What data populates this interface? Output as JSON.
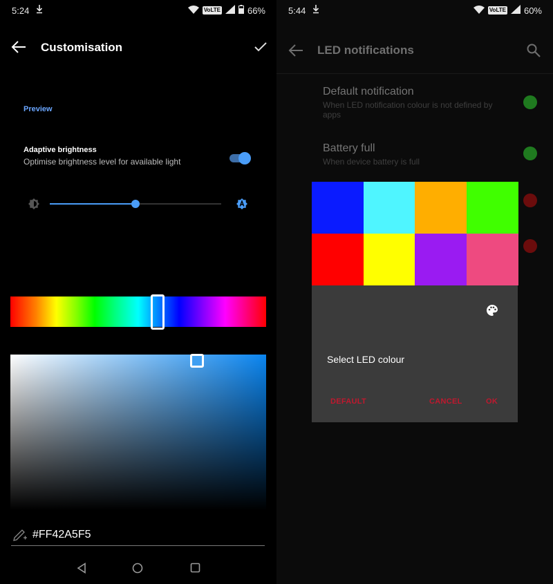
{
  "left": {
    "status_bar": {
      "time": "5:24",
      "network_badge": "VoLTE",
      "battery": "66%"
    },
    "app_bar": {
      "title": "Customisation"
    },
    "section_header": "Preview",
    "adaptive_brightness": {
      "title": "Adaptive brightness",
      "summary": "Optimise brightness level for available light",
      "enabled": true
    },
    "brightness_slider": {
      "level": 0.5
    },
    "hue_slider": {
      "position": 0.575
    },
    "color_field": {
      "selected_color": "#42A5F5"
    },
    "hex_input": {
      "value": "#FF42A5F5"
    },
    "accent_color": "#4a9df8"
  },
  "right": {
    "status_bar": {
      "time": "5:44",
      "network_badge": "VoLTE",
      "battery": "60%"
    },
    "app_bar": {
      "title": "LED notifications"
    },
    "list": [
      {
        "title": "Default notification",
        "summary": "When LED notification colour is not defined by apps",
        "dot_color": "#1f7a1f"
      },
      {
        "title": "Battery full",
        "summary": "When device battery is full",
        "dot_color": "#1f7a1f"
      },
      {
        "title": "",
        "summary": "",
        "dot_color": "#6b0c0c"
      },
      {
        "title": "",
        "summary": "",
        "dot_color": "#6b0c0c"
      }
    ],
    "dialog": {
      "swatches": [
        "#0a1bff",
        "#4ff5ff",
        "#ffae00",
        "#40ff00",
        "#ff0000",
        "#ffff00",
        "#9a1bf2",
        "#ee4a80"
      ],
      "title": "Select LED colour",
      "buttons": {
        "default": "DEFAULT",
        "cancel": "CANCEL",
        "ok": "OK"
      }
    }
  }
}
